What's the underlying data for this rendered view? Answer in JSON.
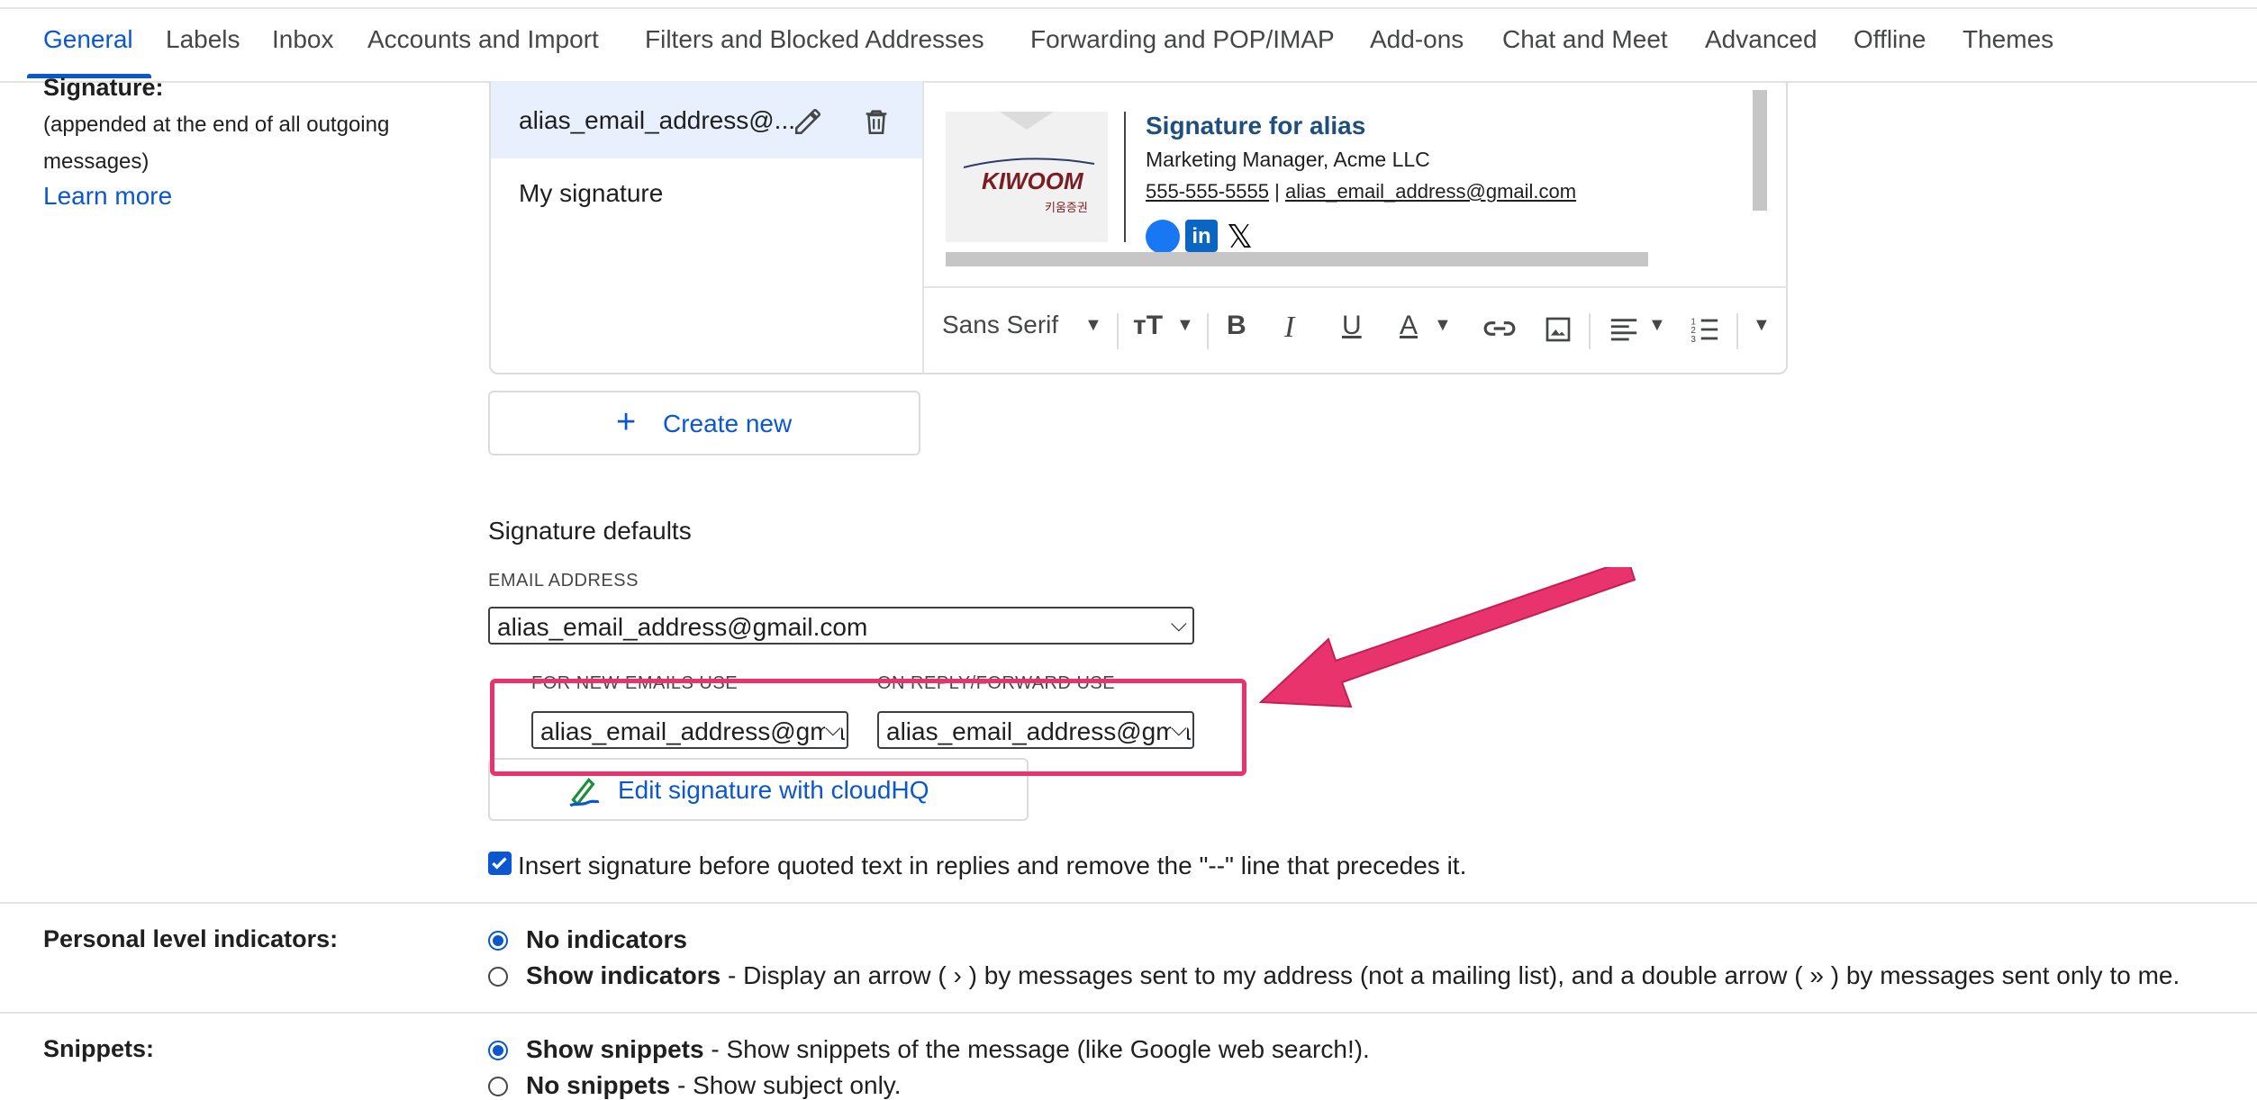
{
  "tabs": [
    "General",
    "Labels",
    "Inbox",
    "Accounts and Import",
    "Filters and Blocked Addresses",
    "Forwarding and POP/IMAP",
    "Add-ons",
    "Chat and Meet",
    "Advanced",
    "Offline",
    "Themes"
  ],
  "signature": {
    "label": "Signature:",
    "sublabel_line1": "(appended at the end of all outgoing",
    "sublabel_line2": "messages)",
    "learn_more": "Learn more",
    "list": [
      "alias_email_address@...",
      "My signature"
    ],
    "preview": {
      "name": "Signature for alias",
      "title": "Marketing Manager, Acme LLC",
      "phone": "555-555-5555",
      "separator": " | ",
      "email": "alias_email_address@gmail.com",
      "image_text": "KIWOOM",
      "image_small": "키움증권"
    },
    "toolbar": {
      "font": "Sans Serif"
    },
    "create_new": "Create new",
    "defaults_heading": "Signature defaults",
    "email_address_caption": "EMAIL ADDRESS",
    "email_address_value": "alias_email_address@gmail.com",
    "new_emails_caption": "FOR NEW EMAILS USE",
    "new_emails_value": "alias_email_address@gmail.com",
    "reply_caption": "ON REPLY/FORWARD USE",
    "reply_value": "alias_email_address@gmail.com",
    "cloudhq_button": "Edit signature with cloudHQ",
    "insert_checkbox_label": "Insert signature before quoted text in replies and remove the \"--\" line that precedes it.",
    "insert_checked": true
  },
  "indicators": {
    "label": "Personal level indicators:",
    "opt1_bold": "No indicators",
    "opt2_bold": "Show indicators",
    "opt2_desc": " - Display an arrow ( › ) by messages sent to my address (not a mailing list), and a double arrow ( » ) by messages sent only to me.",
    "selected": "No indicators"
  },
  "snippets": {
    "label": "Snippets:",
    "opt1_bold": "Show snippets",
    "opt1_desc": " - Show snippets of the message (like Google web search!).",
    "opt2_bold": "No snippets",
    "opt2_desc": " - Show subject only.",
    "selected": "Show snippets"
  },
  "colors": {
    "accent": "#0b57d0",
    "annotation": "#e8336d"
  }
}
